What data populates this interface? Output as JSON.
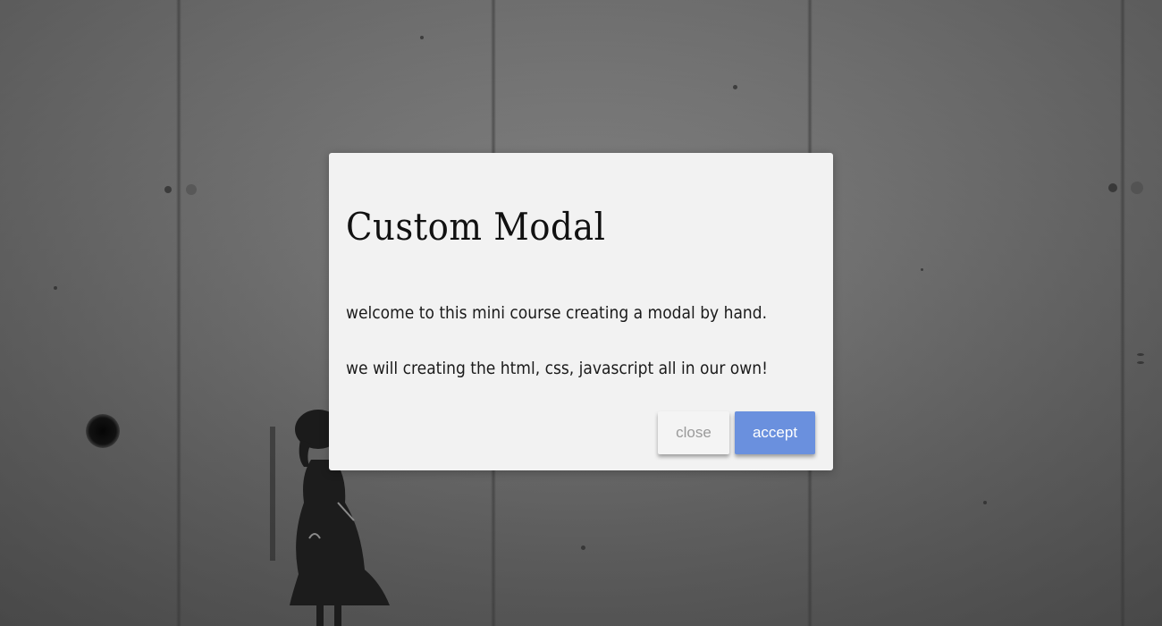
{
  "background": {
    "description_icon": "concrete-wall-with-stencil-girl"
  },
  "modal": {
    "title": "Custom Modal",
    "paragraphs": [
      "welcome to this mini course creating a modal by hand.",
      "we will creating the html, css, javascript all in our own!"
    ],
    "buttons": {
      "close_label": "close",
      "accept_label": "accept"
    },
    "colors": {
      "modal_bg": "#f2f2f2",
      "accept_bg": "#6a90de",
      "close_bg": "#f4f4f4",
      "close_text": "#9a9a9a"
    }
  }
}
